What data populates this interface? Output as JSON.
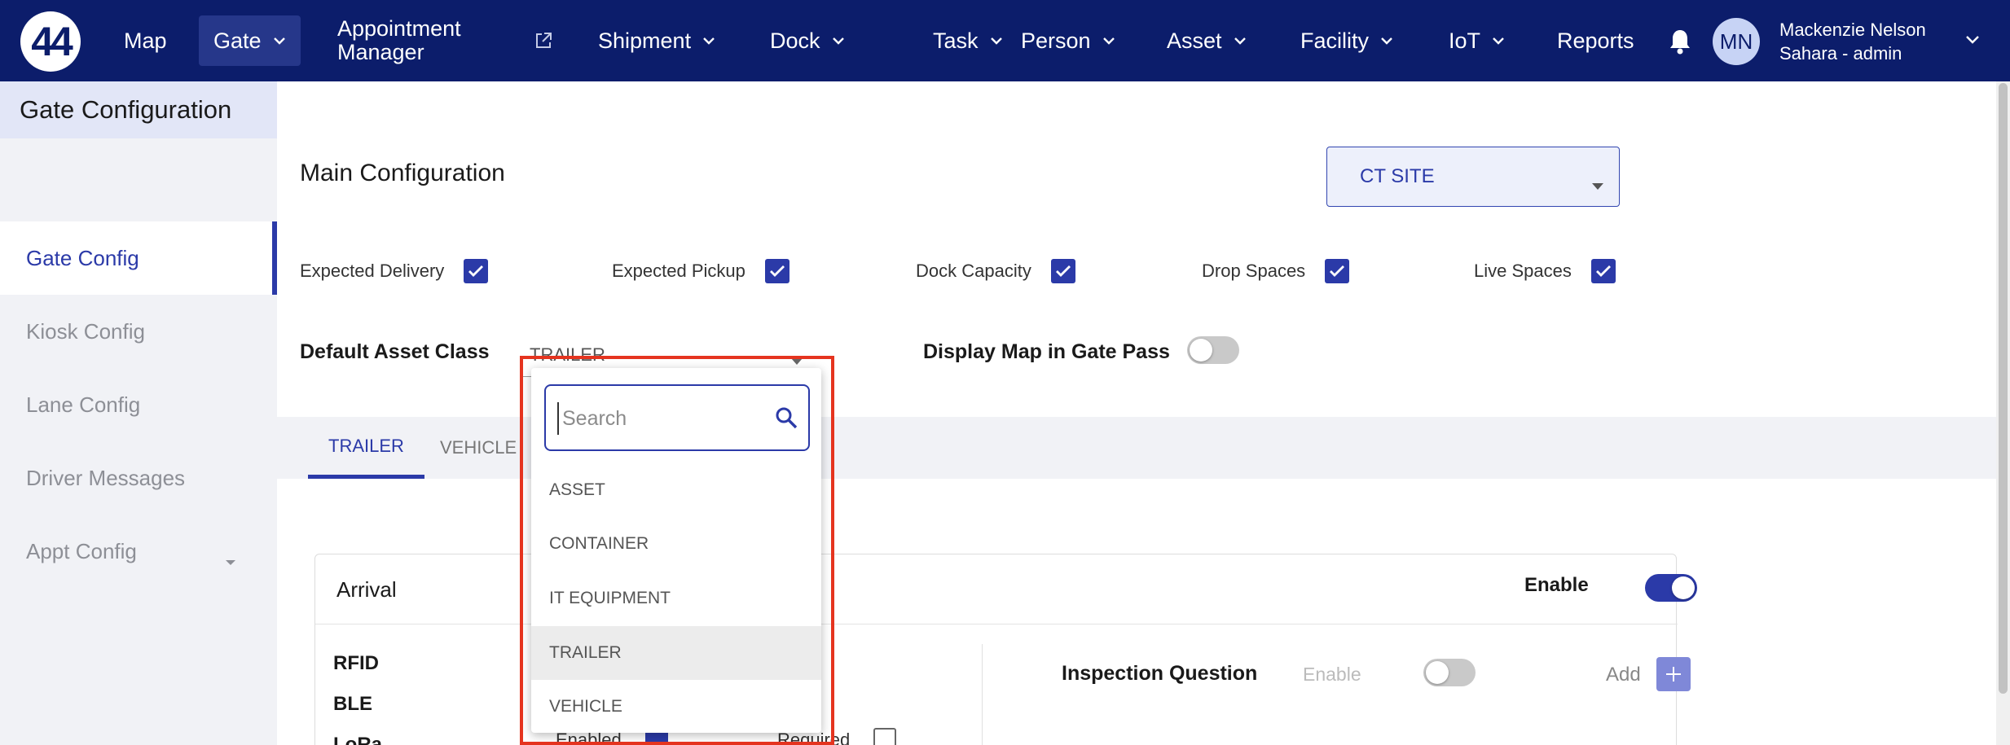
{
  "nav": {
    "logo": "44",
    "items": [
      {
        "label": "Map"
      },
      {
        "label": "Gate"
      },
      {
        "label_line1": "Appointment",
        "label_line2": "Manager"
      },
      {
        "label": "Shipment"
      },
      {
        "label": "Dock"
      },
      {
        "label": "Task"
      },
      {
        "label": "Person"
      },
      {
        "label": "Asset"
      },
      {
        "label": "Facility"
      },
      {
        "label": "IoT"
      },
      {
        "label": "Reports"
      }
    ],
    "user": {
      "initials": "MN",
      "name": "Mackenzie Nelson",
      "role": "Sahara - admin"
    }
  },
  "sidebar": {
    "title": "Gate Configuration",
    "items": [
      {
        "label": "Gate Config"
      },
      {
        "label": "Kiosk Config"
      },
      {
        "label": "Lane Config"
      },
      {
        "label": "Driver Messages"
      },
      {
        "label": "Appt Config"
      }
    ]
  },
  "main": {
    "title": "Main Configuration",
    "site_select": "CT SITE",
    "checks": [
      {
        "label": "Expected Delivery"
      },
      {
        "label": "Expected Pickup"
      },
      {
        "label": "Dock Capacity"
      },
      {
        "label": "Drop Spaces"
      },
      {
        "label": "Live Spaces"
      }
    ],
    "default_asset_label": "Default Asset Class",
    "default_asset_value": "TRAILER",
    "display_map_label": "Display Map in Gate Pass",
    "tabs": [
      {
        "label": "TRAILER"
      },
      {
        "label": "VEHICLE"
      }
    ],
    "card": {
      "title": "Arrival",
      "enable_label": "Enable",
      "rows": [
        {
          "label": "RFID"
        },
        {
          "label": "BLE"
        },
        {
          "label": "LoRa"
        }
      ],
      "lora_enabled": "Enabled",
      "lora_required": "Required",
      "inspection_label": "Inspection Question",
      "inspection_enable": "Enable",
      "add_label": "Add"
    }
  },
  "dropdown": {
    "search_placeholder": "Search",
    "options": [
      {
        "label": "ASSET"
      },
      {
        "label": "CONTAINER"
      },
      {
        "label": "IT EQUIPMENT"
      },
      {
        "label": "TRAILER"
      },
      {
        "label": "VEHICLE"
      }
    ],
    "selected": "TRAILER"
  },
  "colors": {
    "nav_bg": "#0c1d6b",
    "accent": "#2b3aa8",
    "highlight": "#e5341f"
  }
}
